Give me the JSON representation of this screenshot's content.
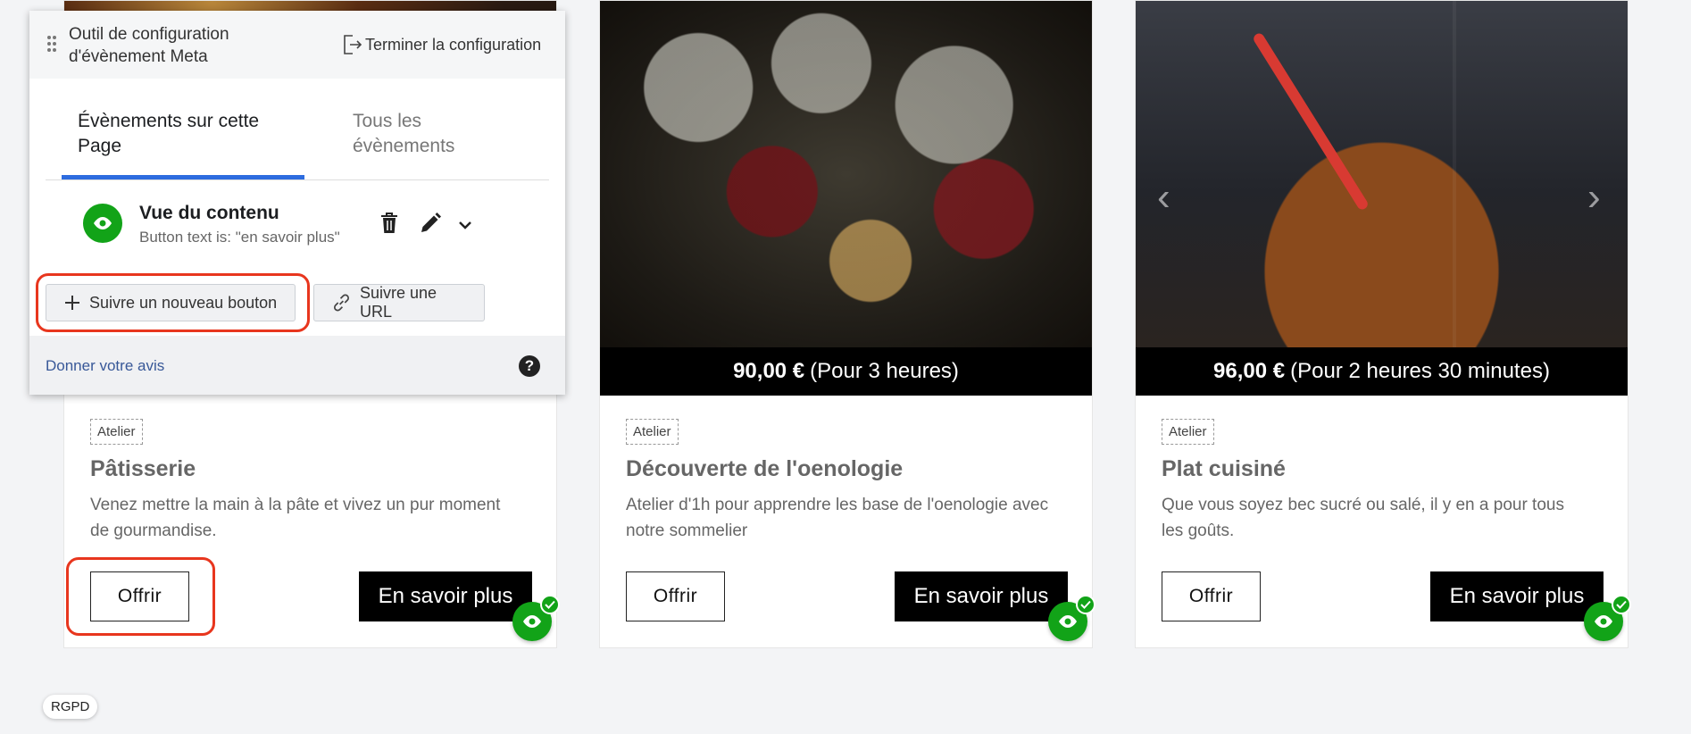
{
  "meta_panel": {
    "title": "Outil de configuration d'évènement Meta",
    "finish_label": "Terminer la configuration",
    "tabs": [
      {
        "label": "Évènements sur cette Page",
        "active": true
      },
      {
        "label": "Tous les évènements",
        "active": false
      }
    ],
    "event": {
      "name": "Vue du contenu",
      "detail": "Button text is: \"en savoir plus\""
    },
    "track_new_button_label": "Suivre un nouveau bouton",
    "track_url_label": "Suivre une URL",
    "feedback_label": "Donner votre avis",
    "help_symbol": "?"
  },
  "cards": [
    {
      "price_amount": "",
      "price_detail": "",
      "tag": "Atelier",
      "title": "Pâtisserie",
      "description": "Venez mettre la main à la pâte et vivez un pur moment de gourmandise.",
      "offer_label": "Offrir",
      "learn_more_label": "En savoir plus"
    },
    {
      "price_amount": "90,00 €",
      "price_detail": "(Pour 3 heures)",
      "tag": "Atelier",
      "title": "Découverte de l'oenologie",
      "description": "Atelier d'1h pour apprendre les base de l'oenologie avec notre sommelier",
      "offer_label": "Offrir",
      "learn_more_label": "En savoir plus"
    },
    {
      "price_amount": "96,00 €",
      "price_detail": "(Pour 2 heures 30 minutes)",
      "tag": "Atelier",
      "title": "Plat cuisiné",
      "description": "Que vous soyez bec sucré ou salé, il y en a pour tous les goûts.",
      "offer_label": "Offrir",
      "learn_more_label": "En savoir plus"
    }
  ],
  "carousel": {
    "prev_symbol": "‹",
    "next_symbol": "›"
  },
  "rgpd_label": "RGPD",
  "colors": {
    "accent_green": "#12a318",
    "tab_blue": "#2d6cdf",
    "highlight_red": "#e8361e"
  }
}
